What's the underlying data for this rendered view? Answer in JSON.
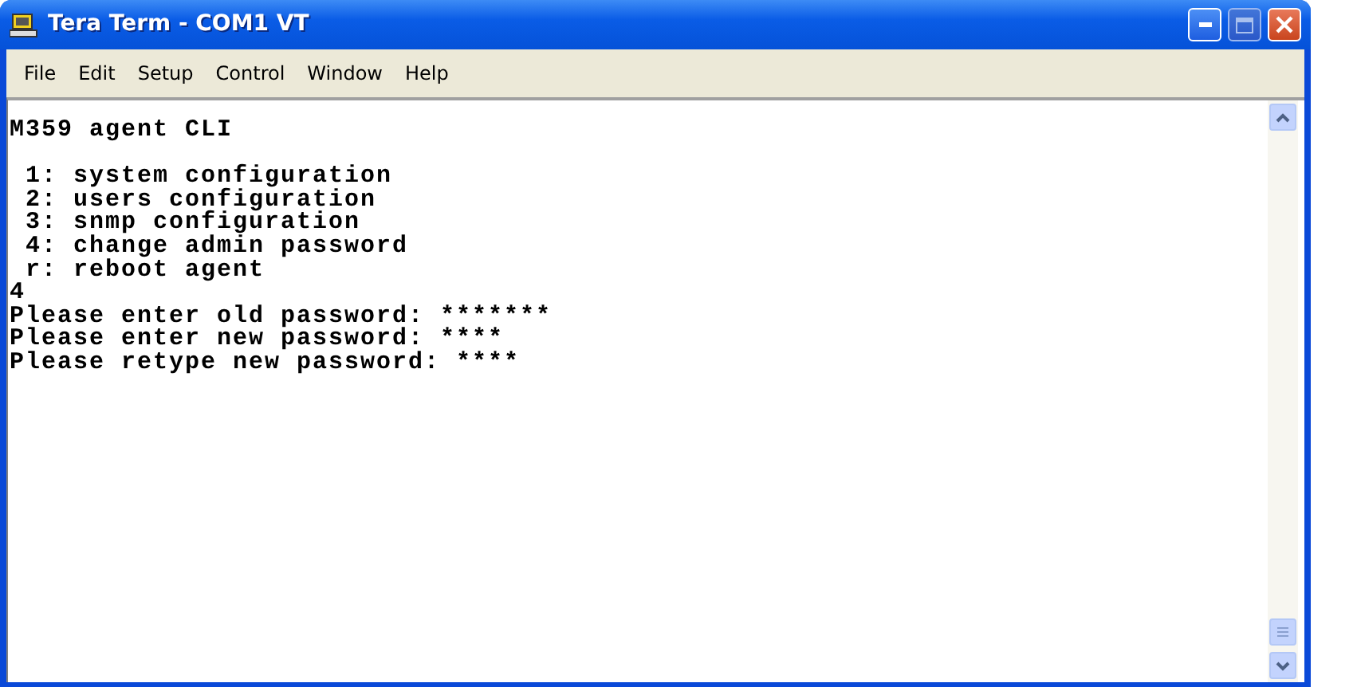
{
  "window": {
    "title": "Tera Term - COM1 VT"
  },
  "menu": [
    {
      "label": "File"
    },
    {
      "label": "Edit"
    },
    {
      "label": "Setup"
    },
    {
      "label": "Control"
    },
    {
      "label": "Window"
    },
    {
      "label": "Help"
    }
  ],
  "terminal": {
    "blocks": [
      [
        "M359 agent CLI"
      ],
      [
        " 1: system configuration",
        " 2: users configuration",
        " 3: snmp configuration",
        " 4: change admin password",
        " r: reboot agent",
        "4",
        "Please enter old password: *******",
        "Please enter new password: ****",
        "Please retype new password: ****"
      ]
    ]
  }
}
